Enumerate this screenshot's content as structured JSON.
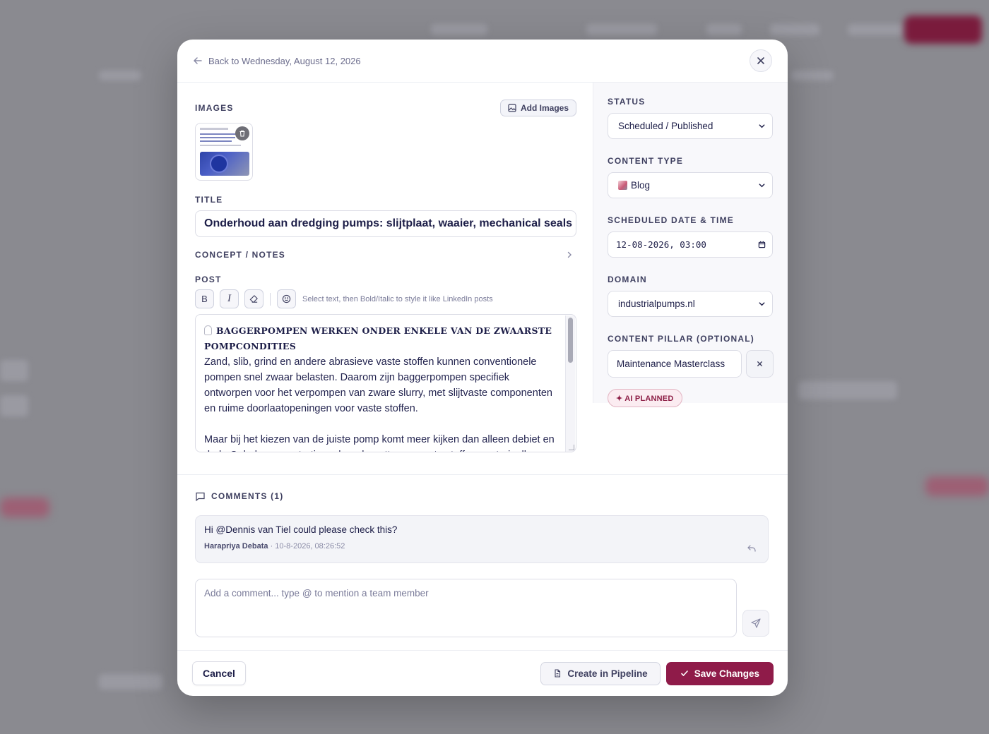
{
  "modal": {
    "back_label": "Back to Wednesday, August 12, 2026",
    "images_label": "Images",
    "add_images_label": "Add Images",
    "title_label": "Title",
    "title_value": "Onderhoud aan dredging pumps: slijtplaat, waaier, mechanical seals",
    "concept_label": "Concept / Notes",
    "post_label": "Post",
    "toolbar": {
      "bold": "B",
      "italic": "I",
      "hint": "Select text, then Bold/Italic to style it like LinkedIn posts"
    },
    "post": {
      "heading": "BAGGERPOMPEN WERKEN ONDER ENKELE VAN DE ZWAARSTE POMPCONDITIES",
      "paragraph1": "Zand, slib, grind en andere abrasieve vaste stoffen kunnen conventionele pompen snel zwaar belasten. Daarom zijn baggerpompen specifiek ontworpen voor het verpompen van zware slurry, met slijtvaste componenten en ruime doorlaatopeningen voor vaste stoffen.",
      "paragraph2": "Maar bij het kiezen van de juiste pomp komt meer kijken dan alleen debiet en druk. Ook de concentratie en korrelgrootte van vaste stoffen, materiaalkeuze"
    }
  },
  "sidebar": {
    "status_label": "Status",
    "status_value": "Scheduled / Published",
    "content_type_label": "Content Type",
    "content_type_value": "Blog",
    "scheduled_label": "Scheduled Date & Time",
    "scheduled_value": "12-08-2026, 03:00",
    "domain_label": "Domain",
    "domain_value": "industrialpumps.nl",
    "pillar_label": "Content Pillar (Optional)",
    "pillar_value": "Maintenance Masterclass",
    "ai_badge": "✦ AI PLANNED"
  },
  "comments": {
    "heading": "Comments (1)",
    "items": [
      {
        "text": "Hi @Dennis van Tiel could please check this?",
        "author": "Harapriya Debata",
        "timestamp": "· 10-8-2026, 08:26:52"
      }
    ],
    "placeholder": "Add a comment... type @ to mention a team member"
  },
  "footer": {
    "cancel": "Cancel",
    "pipeline": "Create in Pipeline",
    "save": "Save Changes"
  },
  "colors": {
    "accent": "#8f1b49",
    "badge_bg": "#fbecf1",
    "text_dark": "#1d1e48"
  },
  "icons": [
    "arrow-left-icon",
    "close-icon",
    "image-icon",
    "trash-icon",
    "chevron-right-icon",
    "eraser-icon",
    "smile-icon",
    "chevron-down-icon",
    "calendar-icon",
    "comment-icon",
    "reply-icon",
    "send-icon",
    "document-icon",
    "check-icon"
  ]
}
